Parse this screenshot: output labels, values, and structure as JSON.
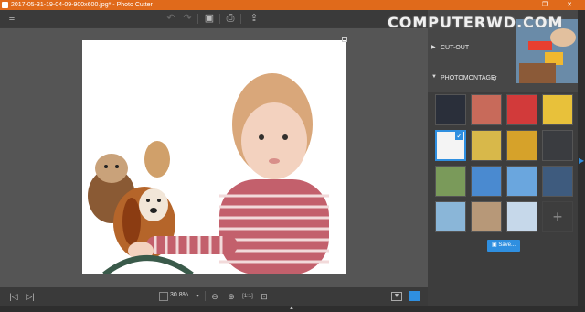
{
  "window": {
    "title": "2017-05-31-19-04-09-900x600.jpg* - Photo Cutter",
    "minimize": "—",
    "maximize": "❐",
    "close": "✕"
  },
  "toolbar": {
    "menu_icon": "≡",
    "undo": "↶",
    "redo": "↷",
    "save": "▣",
    "print": "⎙",
    "share": "⇪"
  },
  "bottom": {
    "prev": "|◁",
    "next": "▷|",
    "zoom": "30.8%",
    "zoom_out": "⊖",
    "zoom_in": "⊕",
    "fit": "[1:1]",
    "zoom_fit": "⊡"
  },
  "panel": {
    "logo": "COMPUTERWD.COM",
    "sections": [
      {
        "label": "CUT-OUT",
        "chevron": "▶"
      },
      {
        "label": "PHOTOMONTAGE",
        "chevron": "▼",
        "icon": "↺"
      }
    ],
    "save_label": "Save..."
  },
  "thumbnails": [
    {
      "name": "moon",
      "bg": "#2a2f3a"
    },
    {
      "name": "hearts-sunset",
      "bg": "#c86a5a"
    },
    {
      "name": "red-hearts",
      "bg": "#d23a3a"
    },
    {
      "name": "comic-bubbles",
      "bg": "#e8c13a"
    },
    {
      "name": "blank-white",
      "bg": "#f4f4f4",
      "selected": true
    },
    {
      "name": "yellow-frame",
      "bg": "#d8b84a"
    },
    {
      "name": "gold-bokeh",
      "bg": "#d6a22a"
    },
    {
      "name": "dark-bokeh",
      "bg": "#3a3c40"
    },
    {
      "name": "cow",
      "bg": "#7a9a5a"
    },
    {
      "name": "green-field",
      "bg": "#4a8ad0"
    },
    {
      "name": "snowman",
      "bg": "#6aa6de"
    },
    {
      "name": "city-skyline",
      "bg": "#3e5b7e"
    },
    {
      "name": "harbor",
      "bg": "#8ab6d8"
    },
    {
      "name": "dining-room",
      "bg": "#b79878"
    },
    {
      "name": "winter-trees",
      "bg": "#c6d8ea"
    },
    {
      "name": "add-background",
      "bg": "#3d3d3d",
      "add": true
    }
  ],
  "colors": {
    "accent": "#2f8fe0",
    "titlebar": "#e06a1b"
  }
}
